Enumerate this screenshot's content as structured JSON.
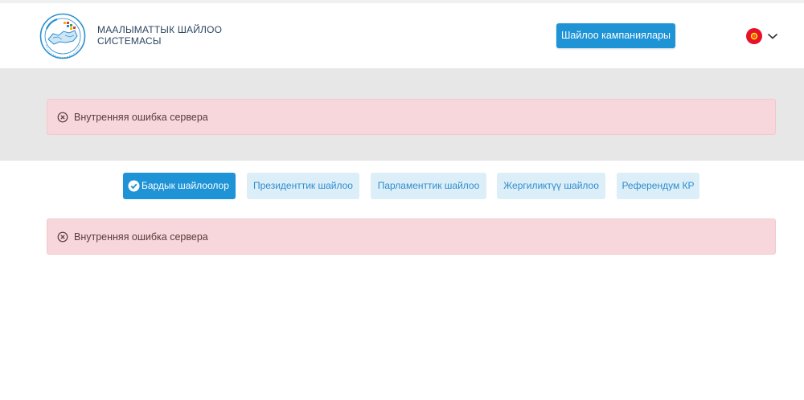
{
  "header": {
    "brand_line1": "МААЛЫМАТТЫК ШАЙЛОО",
    "brand_line2": "СИСТЕМАСЫ",
    "campaigns_button": "Шайлоо кампаниялары",
    "language": {
      "icon": "kyrgyz-flag-icon",
      "toggle_icon": "chevron-down-icon"
    },
    "logo_icon": "election-system-logo"
  },
  "alerts": {
    "top": {
      "icon": "circle-x-icon",
      "text": "Внутренняя ошибка сервера"
    },
    "bottom": {
      "icon": "circle-x-icon",
      "text": "Внутренняя ошибка сервера"
    }
  },
  "tabs": [
    {
      "label": "Бардык шайлоолор",
      "active": true,
      "icon": "check-circle-icon"
    },
    {
      "label": "Президенттик шайлоо",
      "active": false
    },
    {
      "label": "Парламенттик шайлоо",
      "active": false
    },
    {
      "label": "Жергиликтүү шайлоо",
      "active": false
    },
    {
      "label": "Референдум КР",
      "active": false
    }
  ],
  "colors": {
    "accent": "#1e93d6",
    "tab_inactive_bg": "#dceff9",
    "alert_bg": "#f7d7db",
    "band_bg": "#e7e7e7"
  }
}
